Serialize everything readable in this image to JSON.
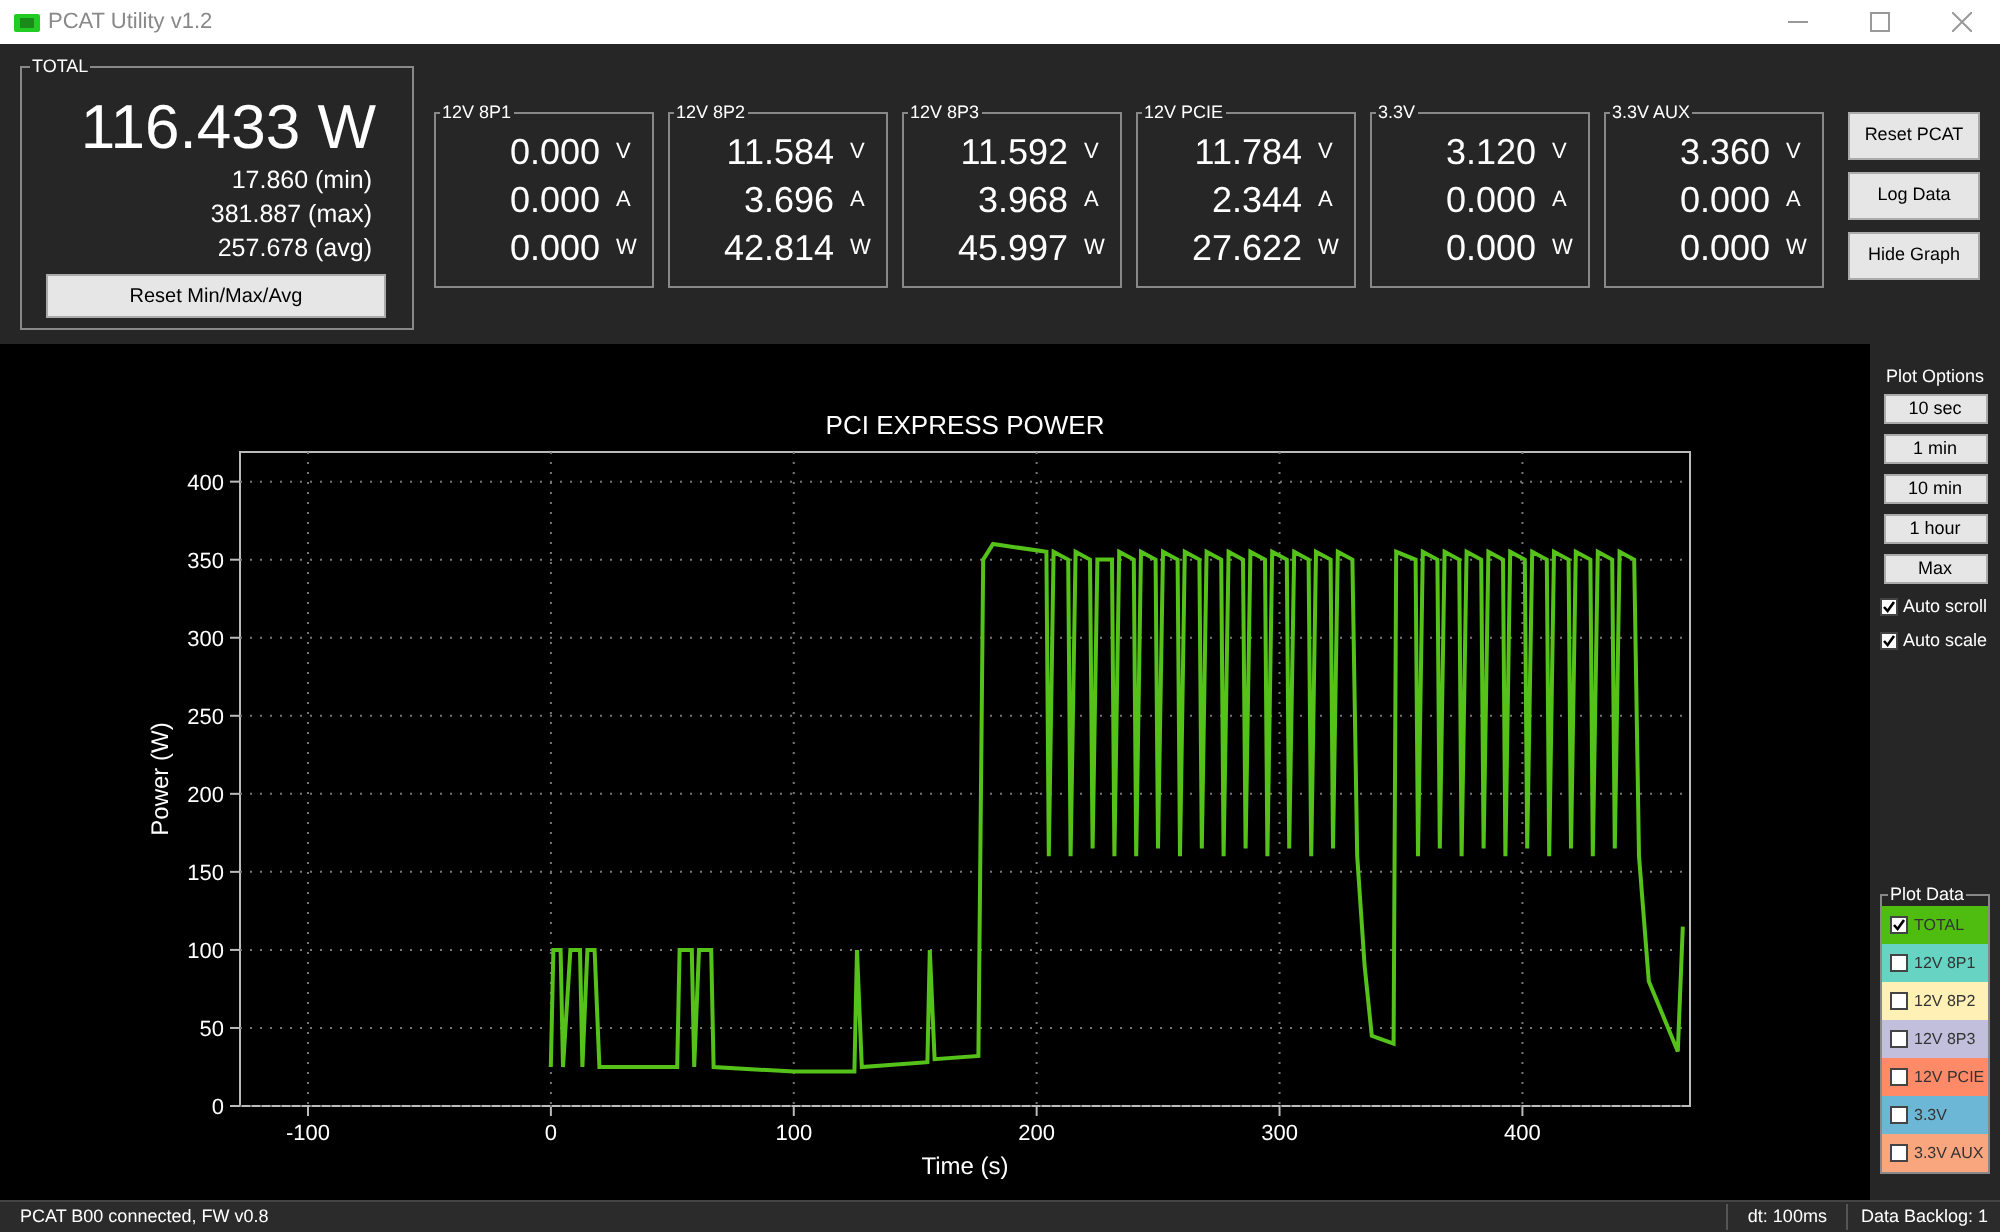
{
  "window": {
    "title": "PCAT Utility v1.2"
  },
  "total": {
    "label": "TOTAL",
    "value": "116.433 W",
    "stats": [
      "17.860 (min)",
      "381.887 (max)",
      "257.678 (avg)"
    ],
    "reset_button": "Reset Min/Max/Avg"
  },
  "channels": [
    {
      "label": "12V 8P1",
      "readings": [
        {
          "value": "0.000",
          "unit": "V"
        },
        {
          "value": "0.000",
          "unit": "A"
        },
        {
          "value": "0.000",
          "unit": "W"
        }
      ]
    },
    {
      "label": "12V 8P2",
      "readings": [
        {
          "value": "11.584",
          "unit": "V"
        },
        {
          "value": "3.696",
          "unit": "A"
        },
        {
          "value": "42.814",
          "unit": "W"
        }
      ]
    },
    {
      "label": "12V 8P3",
      "readings": [
        {
          "value": "11.592",
          "unit": "V"
        },
        {
          "value": "3.968",
          "unit": "A"
        },
        {
          "value": "45.997",
          "unit": "W"
        }
      ]
    },
    {
      "label": "12V PCIE",
      "readings": [
        {
          "value": "11.784",
          "unit": "V"
        },
        {
          "value": "2.344",
          "unit": "A"
        },
        {
          "value": "27.622",
          "unit": "W"
        }
      ]
    },
    {
      "label": "3.3V",
      "readings": [
        {
          "value": "3.120",
          "unit": "V"
        },
        {
          "value": "0.000",
          "unit": "A"
        },
        {
          "value": "0.000",
          "unit": "W"
        }
      ]
    },
    {
      "label": "3.3V AUX",
      "readings": [
        {
          "value": "3.360",
          "unit": "V"
        },
        {
          "value": "0.000",
          "unit": "A"
        },
        {
          "value": "0.000",
          "unit": "W"
        }
      ]
    }
  ],
  "action_buttons": [
    "Reset PCAT",
    "Log Data",
    "Hide Graph"
  ],
  "chart": {
    "chart_data": {
      "type": "line",
      "title": "PCI EXPRESS POWER",
      "xlabel": "Time (s)",
      "ylabel": "Power (W)",
      "xlim": [
        -128,
        469
      ],
      "ylim": [
        0,
        419
      ],
      "xticks": [
        -100,
        0,
        100,
        200,
        300,
        400
      ],
      "yticks": [
        0,
        50,
        100,
        150,
        200,
        250,
        300,
        350,
        400
      ],
      "x": [
        0,
        1,
        4,
        5,
        8,
        12,
        13,
        15,
        18,
        20,
        52,
        53,
        58,
        59,
        61,
        66,
        67,
        100,
        125,
        126,
        128,
        155,
        156,
        158,
        176,
        178,
        182,
        204,
        205,
        207,
        213,
        214,
        216,
        222,
        223,
        225,
        231,
        232,
        234,
        240,
        241,
        243,
        249,
        250,
        252,
        258,
        259,
        261,
        267,
        268,
        270,
        276,
        277,
        279,
        285,
        286,
        288,
        294,
        295,
        297,
        303,
        304,
        306,
        312,
        313,
        315,
        321,
        322,
        324,
        330,
        332,
        335,
        338,
        347,
        348,
        356,
        357,
        359,
        365,
        366,
        368,
        374,
        375,
        377,
        383,
        384,
        386,
        392,
        393,
        395,
        401,
        402,
        404,
        410,
        411,
        413,
        419,
        420,
        422,
        428,
        429,
        431,
        437,
        438,
        440,
        446,
        448,
        452,
        464,
        466
      ],
      "grid": true,
      "series": [
        {
          "color": "#55c21a",
          "values": [
            25,
            100,
            100,
            25,
            100,
            100,
            25,
            100,
            100,
            25,
            25,
            100,
            100,
            25,
            100,
            100,
            25,
            22,
            22,
            100,
            25,
            28,
            100,
            30,
            32,
            350,
            360,
            355,
            160,
            355,
            350,
            160,
            355,
            350,
            165,
            350,
            350,
            160,
            355,
            350,
            160,
            355,
            350,
            165,
            355,
            350,
            160,
            355,
            350,
            165,
            355,
            350,
            160,
            355,
            350,
            165,
            355,
            350,
            160,
            355,
            350,
            165,
            355,
            350,
            160,
            355,
            350,
            165,
            355,
            350,
            160,
            90,
            45,
            40,
            355,
            350,
            160,
            355,
            350,
            165,
            355,
            350,
            160,
            355,
            350,
            165,
            355,
            350,
            160,
            355,
            350,
            165,
            355,
            350,
            160,
            355,
            350,
            165,
            355,
            350,
            160,
            355,
            350,
            165,
            355,
            350,
            160,
            80,
            35,
            115
          ]
        }
      ]
    }
  },
  "plot_options": {
    "title": "Plot Options",
    "buttons": [
      "10 sec",
      "1 min",
      "10 min",
      "1 hour",
      "Max"
    ],
    "checkboxes": [
      {
        "label": "Auto scroll",
        "checked": true
      },
      {
        "label": "Auto scale",
        "checked": true
      }
    ]
  },
  "plot_data": {
    "title": "Plot Data",
    "items": [
      {
        "label": "TOTAL",
        "color": "#4fbd10",
        "checked": true
      },
      {
        "label": "12V 8P1",
        "color": "#66d3c3",
        "checked": false
      },
      {
        "label": "12V 8P2",
        "color": "#fff0b5",
        "checked": false
      },
      {
        "label": "12V 8P3",
        "color": "#c2bfdc",
        "checked": false
      },
      {
        "label": "12V PCIE",
        "color": "#ff8a68",
        "checked": false
      },
      {
        "label": "3.3V",
        "color": "#6cb6d6",
        "checked": false
      },
      {
        "label": "3.3V AUX",
        "color": "#f9a67e",
        "checked": false
      }
    ]
  },
  "status_bar": {
    "connection": "PCAT B00 connected, FW v0.8",
    "dt": "dt: 100ms",
    "backlog": "Data Backlog: 1"
  }
}
